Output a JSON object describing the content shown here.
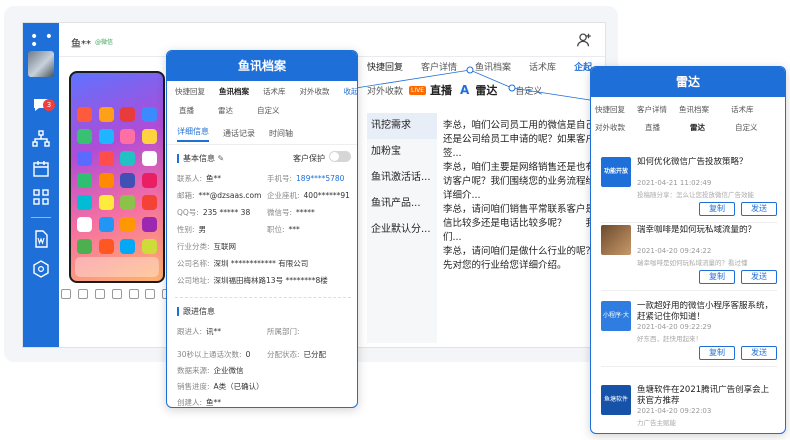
{
  "chat": {
    "contact_name": "鱼**",
    "contact_tag": "@微信",
    "unread_badge": "3"
  },
  "script_panel": {
    "tabs_row1": [
      "快捷回复",
      "客户详情",
      "鱼讯档案",
      "话术库",
      "企起"
    ],
    "tabs_row2": [
      "对外收款",
      "直播",
      "雷达",
      "自定义"
    ],
    "live_badge": "LIVE",
    "categories": [
      "讯挖需求",
      "加粉宝",
      "鱼讯激活话...",
      "鱼讯产品...",
      "企业默认分..."
    ],
    "scripts": [
      "李总，咱们公司员工用的微信是自己的还是公司给员工申请的呢？如果客户回签...",
      "李总，咱们主要是网络销售还是也有拜访客户呢？我们围绕您的业务流程给您详细介...",
      "李总，请问咱们销售平常联系客户是微信比较多还是电话比较多呢？　　我们...",
      "李总，请问咱们是做什么行业的呢？我先对您的行业给您详细介绍。"
    ]
  },
  "profile_card": {
    "title": "鱼讯档案",
    "tabs_row1": [
      "快捷回复",
      "鱼讯档案",
      "话术库",
      "对外收款",
      "收起"
    ],
    "tabs_row2": [
      "直播",
      "雷达",
      "自定义"
    ],
    "subtabs": [
      "详细信息",
      "通话记录",
      "时间轴"
    ],
    "basic_title": "基本信息",
    "protect_label": "客户保护",
    "fields": {
      "contact_k": "联系人:",
      "contact_v": "鱼**",
      "phone_k": "手机号:",
      "phone_v": "189****5780",
      "email_k": "邮箱:",
      "email_v": "***@dzsaas.com",
      "corp_phone_k": "企业座机:",
      "corp_phone_v": "400******91",
      "qq_k": "QQ号:",
      "qq_v": "235 ***** 38",
      "wechat_k": "微信号:",
      "wechat_v": "*****",
      "gender_k": "性别:",
      "gender_v": "男",
      "job_k": "职位:",
      "job_v": "***",
      "industry_k": "行业分类:",
      "industry_v": "互联网",
      "company_k": "公司名称:",
      "company_v": "深圳 ************ 有限公司",
      "address_k": "公司地址:",
      "address_v": "深圳福田梅林路13号 ********8楼"
    },
    "follow_title": "跟进信息",
    "follow": {
      "follower_k": "跟进人:",
      "follower_v": "讯**",
      "dept_k": "所属部门:",
      "dept_v": "",
      "calls_k": "30秒以上通话次数:",
      "calls_v": "0",
      "state_k": "分配状态:",
      "state_v": "已分配",
      "source_k": "数据来源:",
      "source_v": "企业微信",
      "progress_k": "销售进度:",
      "progress_v": "A类（已确认）",
      "creator_k": "创建人:",
      "creator_v": "鱼**"
    }
  },
  "radar_card": {
    "title": "雷达",
    "tabs_row1": [
      "快捷回复",
      "客户详情",
      "鱼讯档案",
      "话术库"
    ],
    "tabs_row2": [
      "对外收款",
      "直播",
      "雷达",
      "自定义"
    ],
    "copy_label": "复制",
    "send_label": "发送",
    "articles": [
      {
        "thumb": "功能开放",
        "title": "如何优化微信广告投放策略？",
        "date": "2021-04-21 11:02:49",
        "desc": "投稿随分享：怎么让您投放微信广告效能"
      },
      {
        "thumb": "",
        "title": "瑞幸咖啡是如何玩私域流量的？",
        "date": "2021-04-20 09:24:22",
        "desc": "瑞幸咖啡是如何玩私域流量的？看过懂"
      },
      {
        "thumb": "小程序·大件",
        "title": "一款超好用的微信小程序客服系统，赶紧记住你知道！",
        "date": "2021-04-20 09:22:29",
        "desc": "好东西，赶快用起来！"
      },
      {
        "thumb": "鱼塘软件",
        "title": "鱼塘软件在2021腾讯广告创享会上获官方推荐",
        "date": "2021-04-20 09:22:03",
        "desc": "力广告主赋能"
      }
    ]
  },
  "colors": {
    "brand_blue": "#1f6fd8",
    "badge_red": "#f03e3e",
    "live_orange": "#ff6a00"
  }
}
